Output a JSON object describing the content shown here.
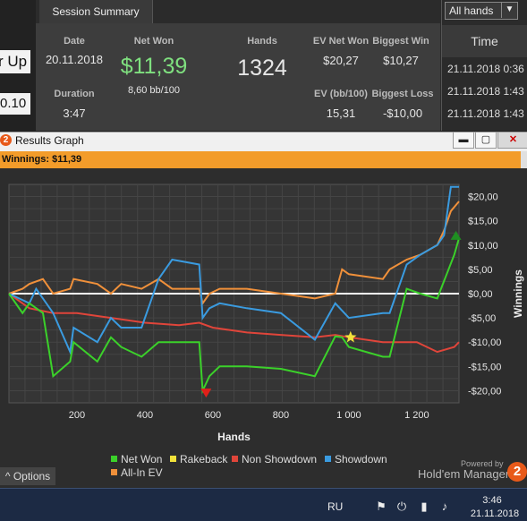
{
  "left_strip": {
    "label": "r Up",
    "value": "0.10"
  },
  "summary": {
    "tab": "Session Summary",
    "date_label": "Date",
    "date": "20.11.2018",
    "duration_label": "Duration",
    "duration": "3:47",
    "net_won_label": "Net Won",
    "net_won": "$11,39",
    "bb_per_100": "8,60 bb/100",
    "hands_label": "Hands",
    "hands": "1324",
    "ev_net_won_label": "EV Net Won",
    "ev_net_won": "$20,27",
    "biggest_win_label": "Biggest Win",
    "biggest_win": "$10,27",
    "ev_bb_label": "EV (bb/100)",
    "ev_bb": "15,31",
    "biggest_loss_label": "Biggest Loss",
    "biggest_loss": "-$10,00"
  },
  "right_panel": {
    "filter": "All hands",
    "time_header": "Time",
    "times": [
      "21.11.2018 0:36",
      "21.11.2018 1:43",
      "21.11.2018 1:43"
    ]
  },
  "window": {
    "title": "Results Graph",
    "icon_glyph": "2",
    "min": "▬",
    "max": "▢",
    "close": "✕"
  },
  "winnings_bar": "Winnings: $11,39",
  "colors": {
    "net_won": "#3bd12a",
    "rakeback": "#f2e23a",
    "non_showdown": "#e0453a",
    "showdown": "#3a9be0",
    "all_in_ev": "#f0903a",
    "accent": "#f39c2a"
  },
  "chart_data": {
    "type": "line",
    "xlabel": "Hands",
    "ylabel": "Winnings",
    "xlim": [
      0,
      1324
    ],
    "ylim": [
      -22.5,
      22.5
    ],
    "x_ticks": [
      "200",
      "400",
      "600",
      "800",
      "1 000",
      "1 200"
    ],
    "y_ticks": [
      "$20,00",
      "$15,00",
      "$10,00",
      "$5,00",
      "$0,00",
      "-$5,00",
      "-$10,00",
      "-$15,00",
      "-$20,00"
    ],
    "grid": true,
    "legend_position": "bottom",
    "series": [
      {
        "name": "Net Won",
        "x": [
          0,
          40,
          60,
          100,
          130,
          180,
          190,
          260,
          300,
          330,
          390,
          440,
          480,
          560,
          570,
          590,
          620,
          700,
          800,
          900,
          960,
          980,
          1000,
          1100,
          1120,
          1170,
          1210,
          1260,
          1310,
          1324
        ],
        "y": [
          0,
          -4,
          -2,
          -4,
          -17,
          -14,
          -10,
          -14,
          -9,
          -11,
          -13,
          -10,
          -10,
          -10,
          -20,
          -17,
          -15,
          -15,
          -15.5,
          -17,
          -8.8,
          -9,
          -11,
          -13,
          -13,
          1,
          0,
          -1,
          8,
          11.39
        ]
      },
      {
        "name": "Rakeback",
        "x": [
          0,
          1324
        ],
        "y": [
          0,
          0
        ]
      },
      {
        "name": "Non Showdown",
        "x": [
          0,
          60,
          130,
          200,
          300,
          400,
          500,
          560,
          600,
          700,
          800,
          900,
          960,
          1000,
          1100,
          1200,
          1260,
          1310,
          1324
        ],
        "y": [
          0,
          -3,
          -4,
          -4,
          -5,
          -6,
          -6.5,
          -6,
          -7,
          -8,
          -8.5,
          -9,
          -8.5,
          -9,
          -10,
          -10,
          -12,
          -11,
          -10
        ]
      },
      {
        "name": "Showdown",
        "x": [
          0,
          60,
          80,
          130,
          180,
          190,
          260,
          300,
          330,
          390,
          440,
          480,
          560,
          570,
          590,
          620,
          700,
          800,
          900,
          960,
          1000,
          1100,
          1120,
          1170,
          1210,
          1260,
          1280,
          1300,
          1324
        ],
        "y": [
          0,
          -2,
          1,
          -4,
          -12,
          -7,
          -10,
          -5,
          -7,
          -7,
          3,
          7,
          6,
          -5,
          -3,
          -2,
          -3,
          -4,
          -9.5,
          -2,
          -5,
          -4,
          -4,
          6,
          8,
          10,
          12,
          22,
          22
        ]
      },
      {
        "name": "All-In EV",
        "x": [
          0,
          40,
          60,
          100,
          130,
          180,
          190,
          260,
          300,
          330,
          390,
          440,
          480,
          560,
          570,
          590,
          620,
          700,
          800,
          900,
          960,
          980,
          1000,
          1100,
          1120,
          1170,
          1210,
          1260,
          1280,
          1300,
          1324
        ],
        "y": [
          0,
          1,
          2,
          3,
          0,
          1,
          3,
          2,
          0,
          2,
          1,
          3,
          1,
          1,
          -2,
          0,
          1,
          1,
          0,
          -1,
          0,
          5,
          4,
          3,
          5,
          7,
          8,
          10,
          13,
          17,
          19
        ]
      }
    ],
    "markers": [
      {
        "type": "star",
        "x": 1005,
        "y": -9
      },
      {
        "type": "triangle-down",
        "x": 580,
        "y": -20.5
      },
      {
        "type": "triangle-up",
        "x": 1315,
        "y": 12
      }
    ]
  },
  "legend": {
    "items": [
      "Net Won",
      "Rakeback",
      "Non Showdown",
      "Showdown",
      "All-In EV"
    ]
  },
  "footer": {
    "options": "Options",
    "options_arrow": "^",
    "powered_by": "Powered by",
    "brand": "Hold'em Manager",
    "brand_glyph": "2"
  },
  "taskbar": {
    "lang": "RU",
    "time": "3:46",
    "date": "21.11.2018"
  }
}
